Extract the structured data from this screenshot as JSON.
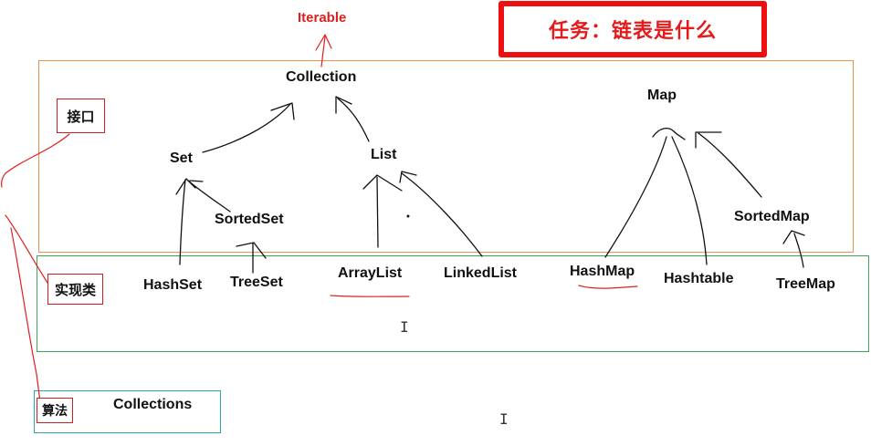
{
  "title": "任务：链表是什么",
  "top_label": "Iterable",
  "sections": {
    "interface": "接口",
    "implementation": "实现类",
    "algorithm": "算法"
  },
  "nodes": {
    "collection": "Collection",
    "set": "Set",
    "list": "List",
    "sorted_set": "SortedSet",
    "map": "Map",
    "sorted_map": "SortedMap",
    "hash_set": "HashSet",
    "tree_set": "TreeSet",
    "array_list": "ArrayList",
    "linked_list": "LinkedList",
    "hash_map": "HashMap",
    "hashtable": "Hashtable",
    "tree_map": "TreeMap",
    "collections": "Collections"
  },
  "colors": {
    "interface_border": "#e8924a",
    "implementation_border": "#3aa655",
    "algorithm_border": "#2aa6a6",
    "annotation_red": "#e02020",
    "stroke": "#111111"
  }
}
